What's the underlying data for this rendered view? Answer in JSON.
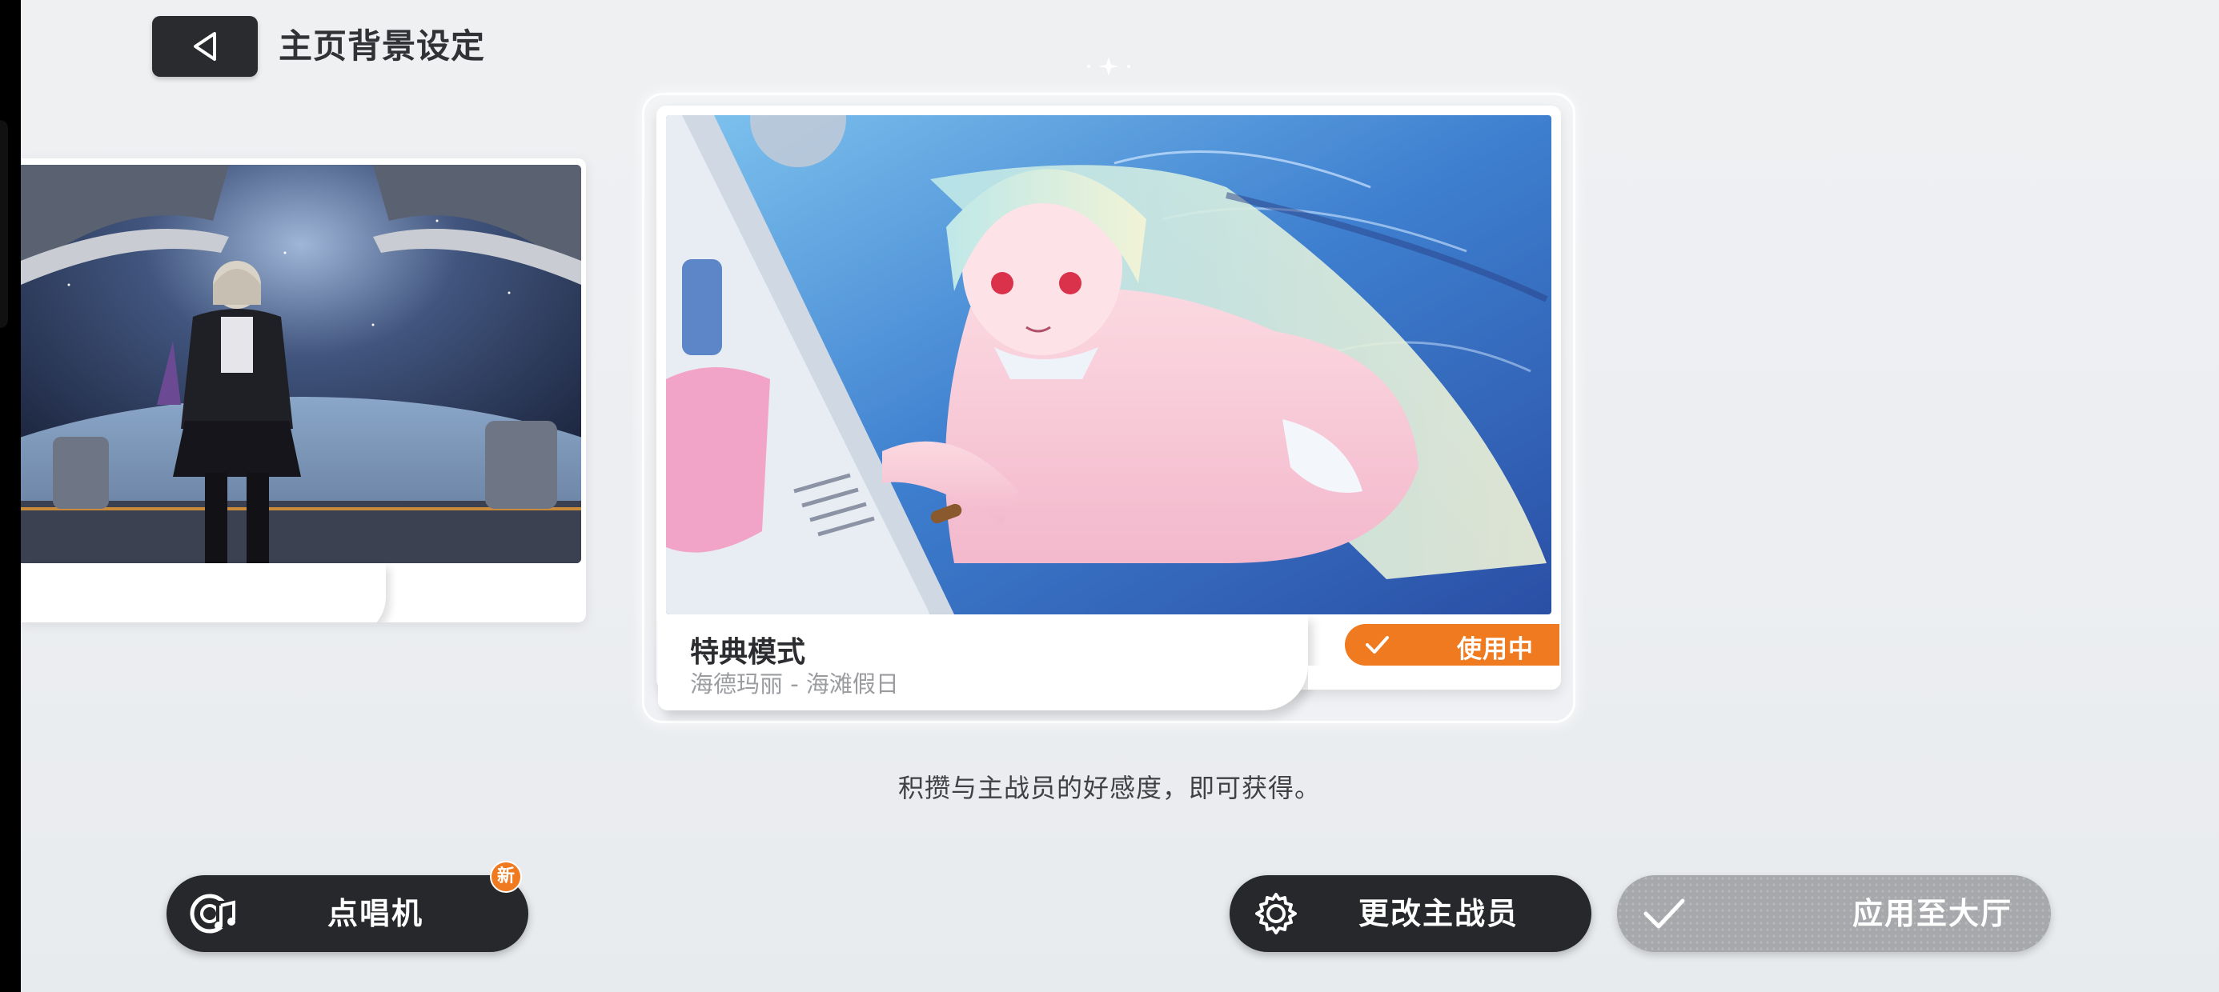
{
  "header": {
    "title": "主页背景设定"
  },
  "selected_background": {
    "mode_label": "特典模式",
    "description": "海德玛丽 - 海滩假日",
    "status_label": "使用中"
  },
  "hint": "积攒与主战员的好感度，即可获得。",
  "buttons": {
    "jukebox_label": "点唱机",
    "jukebox_badge": "新",
    "change_main_label": "更改主战员",
    "apply_label": "应用至大厅"
  },
  "colors": {
    "accent_orange": "#f07a1f",
    "dark_button": "#27282b",
    "disabled_button": "#a6a8ab"
  },
  "icons": {
    "back": "back-triangle-icon",
    "jukebox": "music-disc-icon",
    "change_main": "gear-icon",
    "apply": "check-icon",
    "status": "check-icon"
  }
}
